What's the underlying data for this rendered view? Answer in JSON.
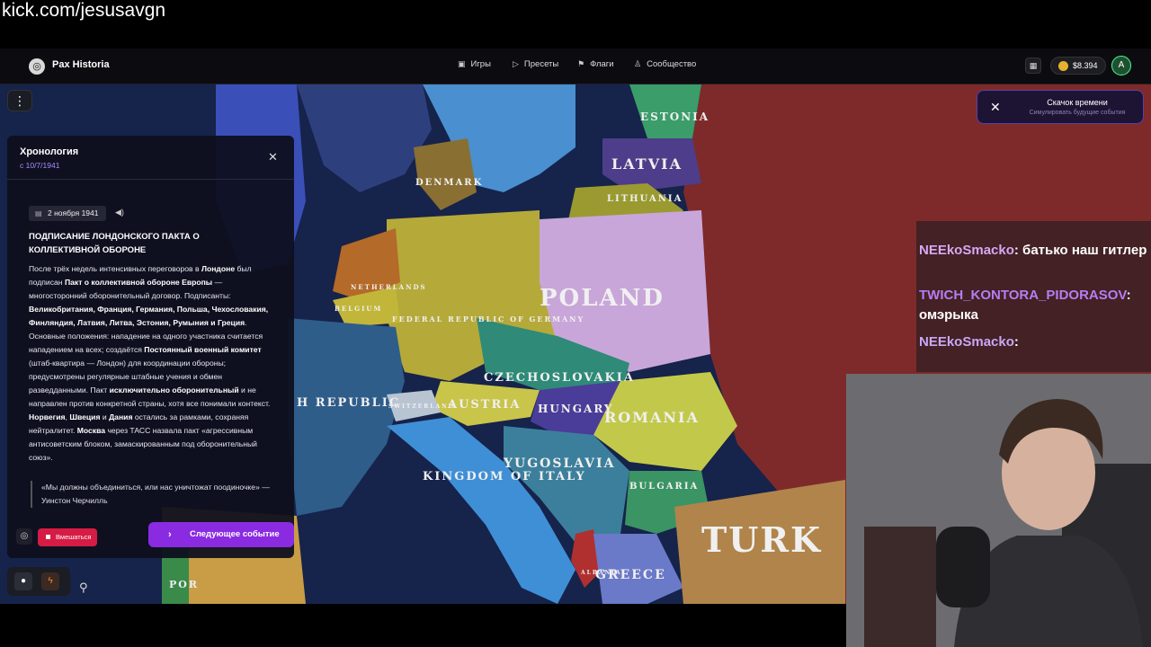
{
  "stream": {
    "url": "kick.com/jesusavgn"
  },
  "header": {
    "brand": "Pax Historia",
    "nav": [
      {
        "label": "Игры",
        "icon": "gamepad-icon"
      },
      {
        "label": "Пресеты",
        "icon": "play-icon"
      },
      {
        "label": "Флаги",
        "icon": "flag-icon"
      },
      {
        "label": "Сообщество",
        "icon": "users-icon"
      }
    ],
    "balance": "$8.394",
    "avatar_letter": "A"
  },
  "timeskip": {
    "title": "Скачок времени",
    "subtitle": "Симулировать будущие события"
  },
  "timeline": {
    "title": "Хронология",
    "since": "с 10/7/1941",
    "event_date": "2 ноября 1941",
    "event_title": "ПОДПИСАНИЕ ЛОНДОНСКОГО ПАКТА О КОЛЛЕКТИВНОЙ ОБОРОНЕ",
    "body": {
      "p1": "После трёх недель интенсивных переговоров в ",
      "p1b": "Лондоне",
      "p2": " был подписан ",
      "p2b": "Пакт о коллективной обороне Европы",
      "p3": " — многосторонний оборонительный договор. Подписанты: ",
      "p3b": "Великобритания, Франция, Германия, Польша, Чехословакия, Финляндия, Латвия, Литва, Эстония, Румыния и Греция",
      "p4": ". Основные положения: нападение на одного участника считается нападением на всех; создаётся ",
      "p4b": "Постоянный военный комитет",
      "p5": " (штаб-квартира — Лондон) для координации обороны; предусмотрены регулярные штабные учения и обмен разведданными. Пакт ",
      "p5b": "исключительно оборонительный",
      "p6": " и не направлен против конкретной страны, хотя все понимали контекст. ",
      "p6b": "Норвегия",
      "p7": ", ",
      "p7b": "Швеция",
      "p8": " и ",
      "p8b": "Дания",
      "p9": " остались за рамками, сохраняя нейтралитет. ",
      "p9b": "Москва",
      "p10": " через ТАСС назвала пакт «агрессивным антисоветским блоком, замаскированным под оборонительный союз»."
    },
    "quote": "«Мы должны объединиться, или нас уничтожат поодиночке» — Уинстон Черчилль",
    "intervene_label": "Вмешаться",
    "next_label": "Следующее событие"
  },
  "map": {
    "labels": {
      "estonia": "ESTONIA",
      "latvia": "LATVIA",
      "lithuania": "LITHUANIA",
      "denmark": "DENMARK",
      "poland": "POLAND",
      "germany": "FEDERAL REPUBLIC OF GERMANY",
      "netherlands": "NETHERLANDS",
      "belgium": "BELGIUM",
      "czechoslovakia": "CZECHOSLOVAKIA",
      "austria": "AUSTRIA",
      "hungary": "HUNGARY",
      "romania": "ROMANIA",
      "yugoslavia": "YUGOSLAVIA",
      "bulgaria": "BULGARIA",
      "italy": "KINGDOM OF ITALY",
      "switzerland": "SWITZERLAND",
      "albania": "ALBANIA",
      "greece": "GREECE",
      "turkey": "TURK",
      "france": "H REPUBLIC",
      "portugal": "POR"
    },
    "colors": {
      "sea": "#16234a",
      "ussr": "#7e2a2a",
      "uk": "#3a4fb8",
      "germany": "#b5a93a",
      "poland": "#c9a6d9",
      "czechoslovakia": "#2f8a78",
      "hungary": "#4a3d99",
      "romania": "#c2c94a",
      "yugoslavia": "#3c7f9c",
      "italy": "#3f8fd6",
      "france": "#2f5d8a",
      "turkey": "#b0844a"
    }
  },
  "chat": [
    {
      "user": "NEEkoSmacko",
      "text": ": батько наш гитлер"
    },
    {
      "user": "TWICH_KONTORA_PIDORASOV",
      "text": ": омэрыка"
    },
    {
      "user": "NEEkoSmacko",
      "text": ": "
    }
  ]
}
